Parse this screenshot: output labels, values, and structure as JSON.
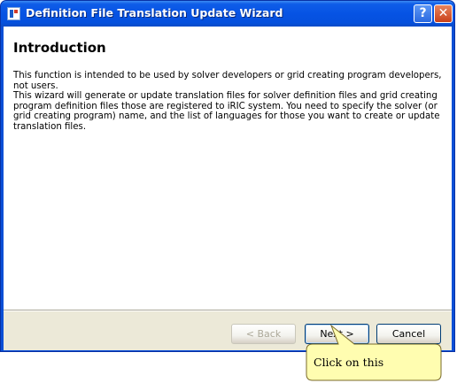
{
  "window": {
    "title": "Definition File Translation Update Wizard",
    "help_glyph": "?",
    "close_glyph": "✕"
  },
  "page": {
    "heading": "Introduction",
    "paragraph1": "This function is intended to be used by solver developers or grid creating program developers, not users.",
    "paragraph2": "This wizard will generate or update translation files for solver definition files and grid creating program definition files those are registered to iRIC system. You need to specify the solver (or grid creating program) name, and the list of languages for those you want to create or update translation files."
  },
  "buttons": {
    "back_label": "< Back",
    "next_label": "Next >",
    "cancel_label": "Cancel"
  },
  "callout": {
    "text": "Click on this"
  },
  "colors": {
    "titlebar": "#0653e4",
    "dialog_face": "#ece9d8",
    "callout_fill": "#fffdb0"
  },
  "icons": [
    "app-icon",
    "help-icon",
    "close-icon"
  ]
}
